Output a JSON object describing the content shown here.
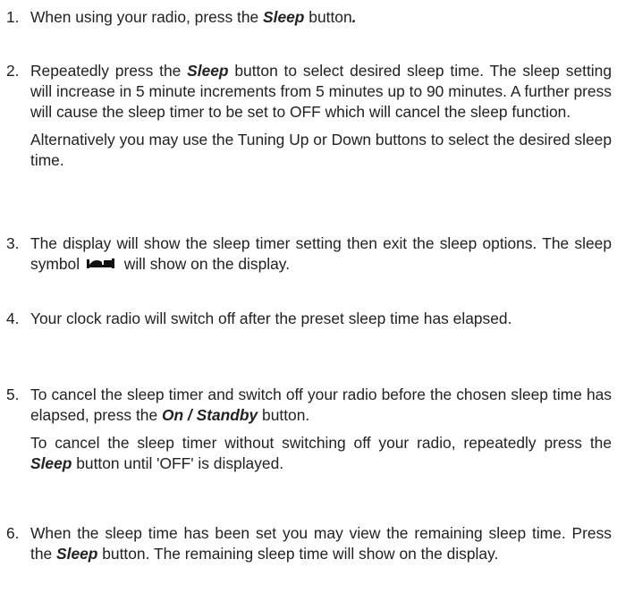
{
  "steps": [
    {
      "number": "1.",
      "p1": {
        "t1": "When using your radio, press the ",
        "k1": "Sleep",
        "t2": " button",
        "k2": "."
      }
    },
    {
      "number": "2.",
      "p1": {
        "t1": "Repeatedly press the ",
        "k1": "Sleep",
        "t2": " button to select desired sleep time. The sleep setting will increase in 5 minute increments from 5 minutes up to 90 minutes. A further press will cause the sleep timer to be set to OFF which will cancel the sleep function."
      },
      "p2": {
        "t1": "Alternatively you may use the Tuning Up or Down buttons to select the desired sleep time."
      }
    },
    {
      "number": "3.",
      "p1": {
        "t1": "The display will show the sleep timer setting then exit the sleep options. The sleep symbol ",
        "icon": "sleep-symbol-icon",
        "t2": " will show on the display."
      }
    },
    {
      "number": "4.",
      "p1": {
        "t1": "Your clock radio will switch off after the preset sleep time has elapsed."
      }
    },
    {
      "number": "5.",
      "p1": {
        "t1": "To cancel the sleep timer and switch off your radio before the chosen sleep time has elapsed, press the ",
        "k1": "On / Standby",
        "t2": " button."
      },
      "p2": {
        "t1": "To cancel the sleep timer without switching off your radio, repeatedly press the ",
        "k1": "Sleep",
        "t2": " button until 'OFF' is displayed."
      }
    },
    {
      "number": "6.",
      "p1": {
        "t1": "When the sleep time has been set you may view the remaining sleep time. Press the ",
        "k1": "Sleep",
        "t2": " button. The remaining sleep time will show on the display."
      }
    }
  ]
}
